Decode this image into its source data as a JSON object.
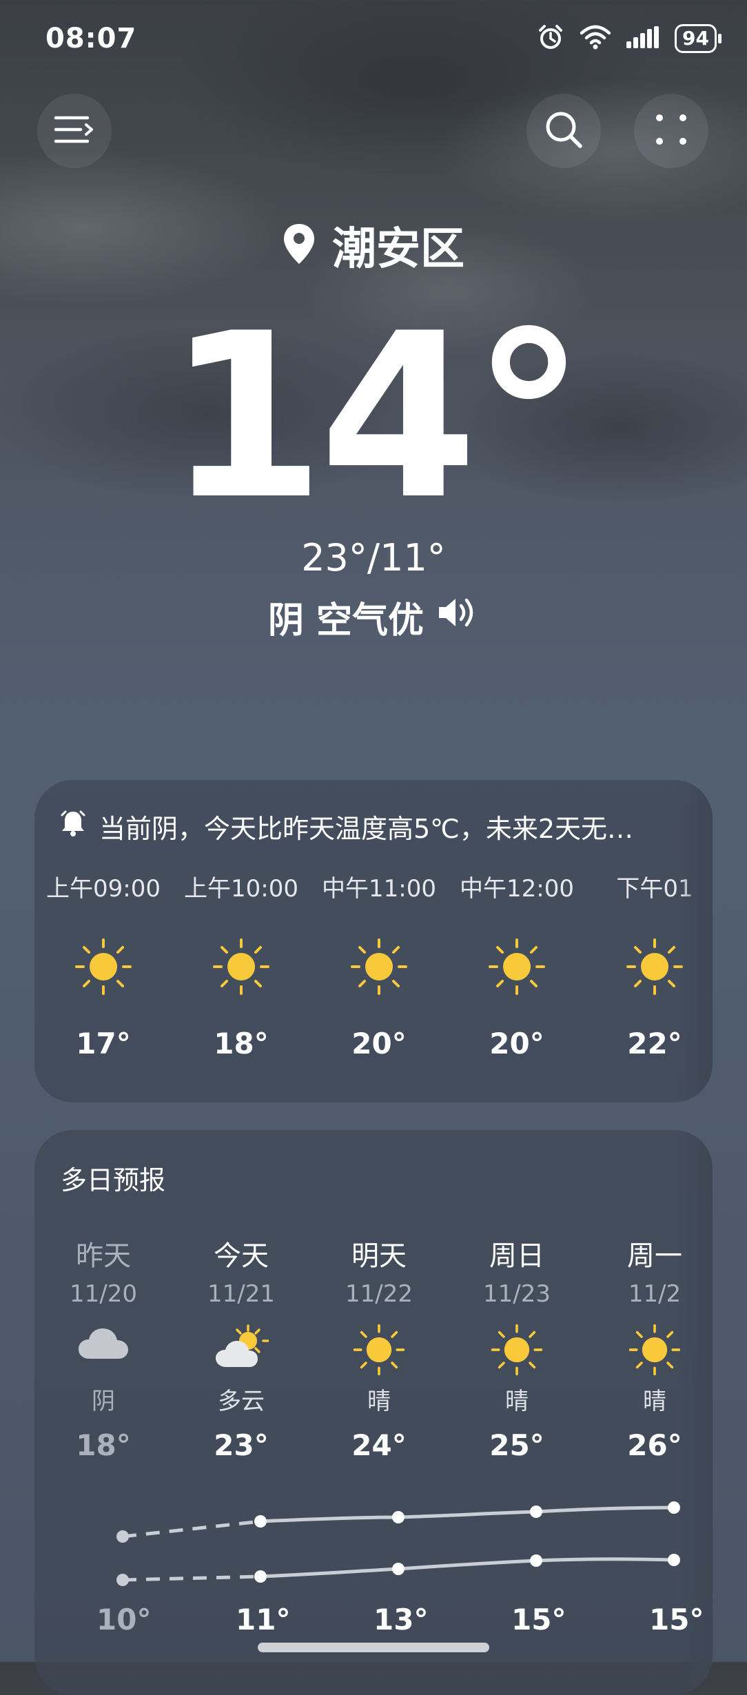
{
  "status_bar": {
    "time": "08:07",
    "battery": "94",
    "icons": [
      "alarm-icon",
      "wifi-icon",
      "signal-icon"
    ]
  },
  "header": {
    "menu_icon": "menu-icon",
    "search_icon": "search-icon",
    "more_icon": "more-dots-icon"
  },
  "location": {
    "name": "潮安区"
  },
  "current": {
    "temp": "14°",
    "high_low": "23°/11°",
    "condition": "阴 空气优"
  },
  "hourly": {
    "alert": "当前阴，今天比昨天温度高5℃，未来2天无…",
    "items": [
      {
        "time": "上午09:00",
        "temp": "17°",
        "icon": "sun-icon"
      },
      {
        "time": "上午10:00",
        "temp": "18°",
        "icon": "sun-icon"
      },
      {
        "time": "中午11:00",
        "temp": "20°",
        "icon": "sun-icon"
      },
      {
        "time": "中午12:00",
        "temp": "20°",
        "icon": "sun-icon"
      },
      {
        "time": "下午01",
        "temp": "22°",
        "icon": "sun-icon"
      }
    ]
  },
  "daily": {
    "title": "多日预报",
    "items": [
      {
        "day": "昨天",
        "date": "11/20",
        "cond": "阴",
        "high": "18°",
        "low": "10°",
        "icon": "cloud-icon"
      },
      {
        "day": "今天",
        "date": "11/21",
        "cond": "多云",
        "high": "23°",
        "low": "11°",
        "icon": "partly-cloudy-icon"
      },
      {
        "day": "明天",
        "date": "11/22",
        "cond": "晴",
        "high": "24°",
        "low": "13°",
        "icon": "sun-icon"
      },
      {
        "day": "周日",
        "date": "11/23",
        "cond": "晴",
        "high": "25°",
        "low": "15°",
        "icon": "sun-icon"
      },
      {
        "day": "周一",
        "date": "11/2",
        "cond": "晴",
        "high": "26°",
        "low": "15°",
        "icon": "sun-icon"
      }
    ]
  },
  "colors": {
    "sun": "#f8c93a",
    "cloud": "#c4c8ce",
    "line": "#c9cdd4"
  }
}
